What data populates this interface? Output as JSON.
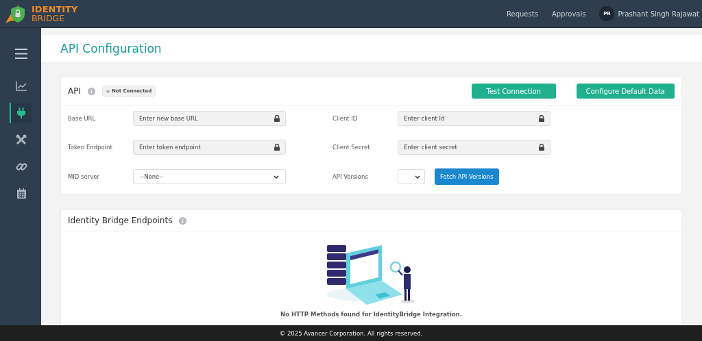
{
  "header": {
    "logo": {
      "line_1": "IDENTITY",
      "line_2": "BRIDGE"
    },
    "nav": [
      "Requests",
      "Approvals"
    ],
    "user": {
      "initials": "PR",
      "name": "Prashant Singh Rajawat"
    }
  },
  "sidebar": {
    "items": [
      {
        "kind": "menu",
        "selected": false
      },
      {
        "kind": "chart",
        "selected": false
      },
      {
        "kind": "plug",
        "selected": true
      },
      {
        "kind": "tools",
        "selected": false
      },
      {
        "kind": "link",
        "selected": false
      },
      {
        "kind": "calendar",
        "selected": false
      }
    ]
  },
  "page": {
    "title": "API Configuration"
  },
  "api_card": {
    "title": "API",
    "status": {
      "label": "Not Connected",
      "connected": false
    },
    "buttons": [
      "Test Connection",
      "Configure Default Data"
    ],
    "fields": [
      {
        "label": "Base URL",
        "kind": "locked",
        "placeholder": "Enter new base URL"
      },
      {
        "label": "Client ID",
        "kind": "locked",
        "placeholder": "Enter client Id"
      },
      {
        "label": "Token Endpoint",
        "kind": "locked",
        "placeholder": "Enter token endpoint"
      },
      {
        "label": "Client Secret",
        "kind": "locked",
        "placeholder": "Enter client secret"
      },
      {
        "label": "MID server",
        "kind": "select",
        "value": "--None--"
      },
      {
        "label": "API Versions",
        "kind": "select_button",
        "button": "Fetch API Versions"
      }
    ]
  },
  "endpoints_card": {
    "title": "Identity Bridge Endpoints",
    "empty_message": "No HTTP Methods found for IdentityBridge Integration."
  },
  "footer": {
    "text": "© 2025 Avancer Corporation. All rights reserved."
  }
}
